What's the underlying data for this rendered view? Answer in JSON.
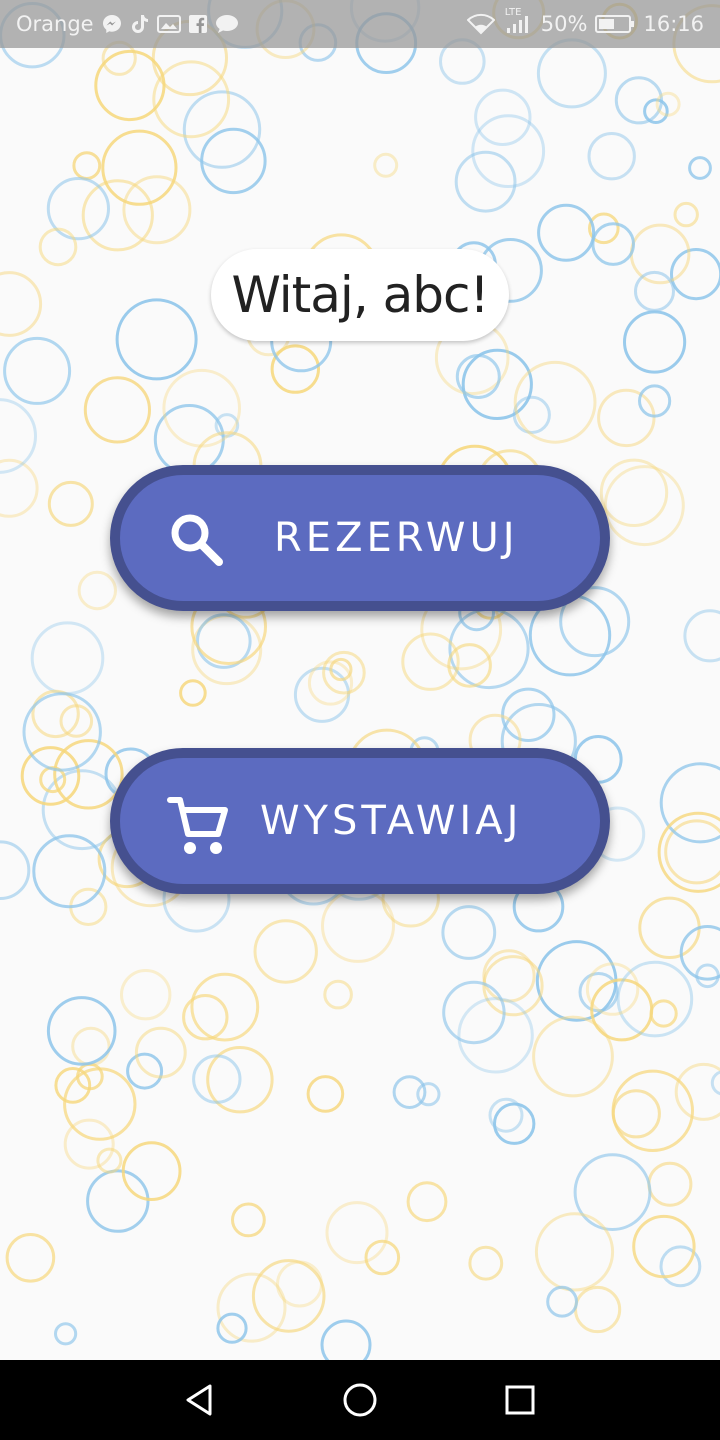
{
  "status_bar": {
    "carrier": "Orange",
    "battery": "50%",
    "time": "16:16",
    "network": "LTE",
    "icons": [
      "messenger-icon",
      "tiktok-icon",
      "gallery-icon",
      "facebook-icon",
      "chat-icon",
      "wifi-icon",
      "signal-icon",
      "battery-icon"
    ]
  },
  "greeting": {
    "text": "Witaj, abc!"
  },
  "buttons": {
    "reserve": {
      "label": "REZERWUJ",
      "icon": "search-icon"
    },
    "list": {
      "label": "WYSTAWIAJ",
      "icon": "cart-icon"
    }
  },
  "colors": {
    "background": "#fafafa",
    "button_fill": "#5c6bc0",
    "button_border": "#45508f",
    "bubble_yellow": "#f6d77c",
    "bubble_blue": "#8ec5ea",
    "status_bar": "#969696",
    "nav_bar": "#000000"
  },
  "nav_bar": {
    "icons": [
      "back-icon",
      "home-icon",
      "recent-apps-icon"
    ]
  }
}
